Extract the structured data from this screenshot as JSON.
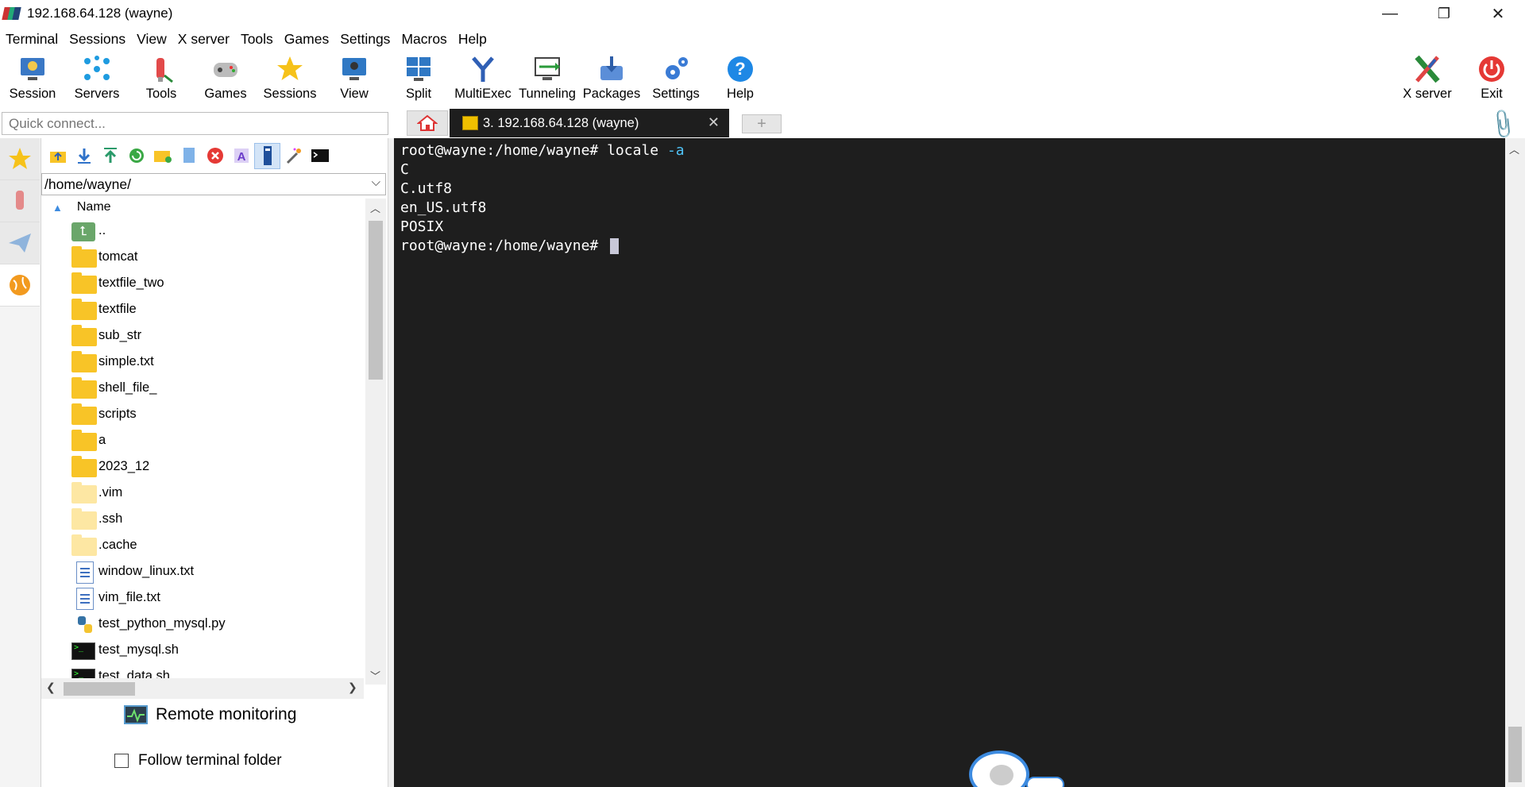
{
  "window": {
    "title": "192.168.64.128 (wayne)",
    "controls": {
      "minimize": "—",
      "restore": "❐",
      "close": "✕"
    }
  },
  "menu": [
    "Terminal",
    "Sessions",
    "View",
    "X server",
    "Tools",
    "Games",
    "Settings",
    "Macros",
    "Help"
  ],
  "toolbar": {
    "session": "Session",
    "servers": "Servers",
    "tools": "Tools",
    "games": "Games",
    "sessions": "Sessions",
    "view": "View",
    "split": "Split",
    "multiexec": "MultiExec",
    "tunneling": "Tunneling",
    "packages": "Packages",
    "settings": "Settings",
    "help": "Help",
    "xserver": "X server",
    "exit": "Exit"
  },
  "quick_connect": {
    "placeholder": "Quick connect..."
  },
  "tabs": {
    "active_label": "3. 192.168.64.128 (wayne)",
    "close": "✕",
    "new": "+"
  },
  "file_browser": {
    "path": "/home/wayne/",
    "column_name": "Name",
    "items": [
      {
        "name": "..",
        "type": "up"
      },
      {
        "name": "tomcat",
        "type": "folder"
      },
      {
        "name": "textfile_two",
        "type": "folder"
      },
      {
        "name": "textfile",
        "type": "folder"
      },
      {
        "name": "sub_str",
        "type": "folder"
      },
      {
        "name": "simple.txt",
        "type": "folder"
      },
      {
        "name": "shell_file_",
        "type": "folder"
      },
      {
        "name": "scripts",
        "type": "folder"
      },
      {
        "name": "a",
        "type": "folder"
      },
      {
        "name": "2023_12",
        "type": "folder"
      },
      {
        "name": ".vim",
        "type": "hidden-folder"
      },
      {
        "name": ".ssh",
        "type": "hidden-folder"
      },
      {
        "name": ".cache",
        "type": "hidden-folder"
      },
      {
        "name": "window_linux.txt",
        "type": "text"
      },
      {
        "name": "vim_file.txt",
        "type": "text"
      },
      {
        "name": "test_python_mysql.py",
        "type": "python"
      },
      {
        "name": "test_mysql.sh",
        "type": "shell"
      },
      {
        "name": "test_data.sh",
        "type": "shell"
      }
    ],
    "remote_monitoring": "Remote monitoring",
    "follow_terminal_folder": "Follow terminal folder"
  },
  "terminal": {
    "prompt": "root@wayne:/home/wayne# ",
    "command": "locale",
    "command_arg": "-a",
    "output": [
      "C",
      "C.utf8",
      "en_US.utf8",
      "POSIX"
    ]
  },
  "colors": {
    "terminal_bg": "#1e1e1e",
    "accent": "#3d8be0",
    "folder": "#f8c427"
  }
}
